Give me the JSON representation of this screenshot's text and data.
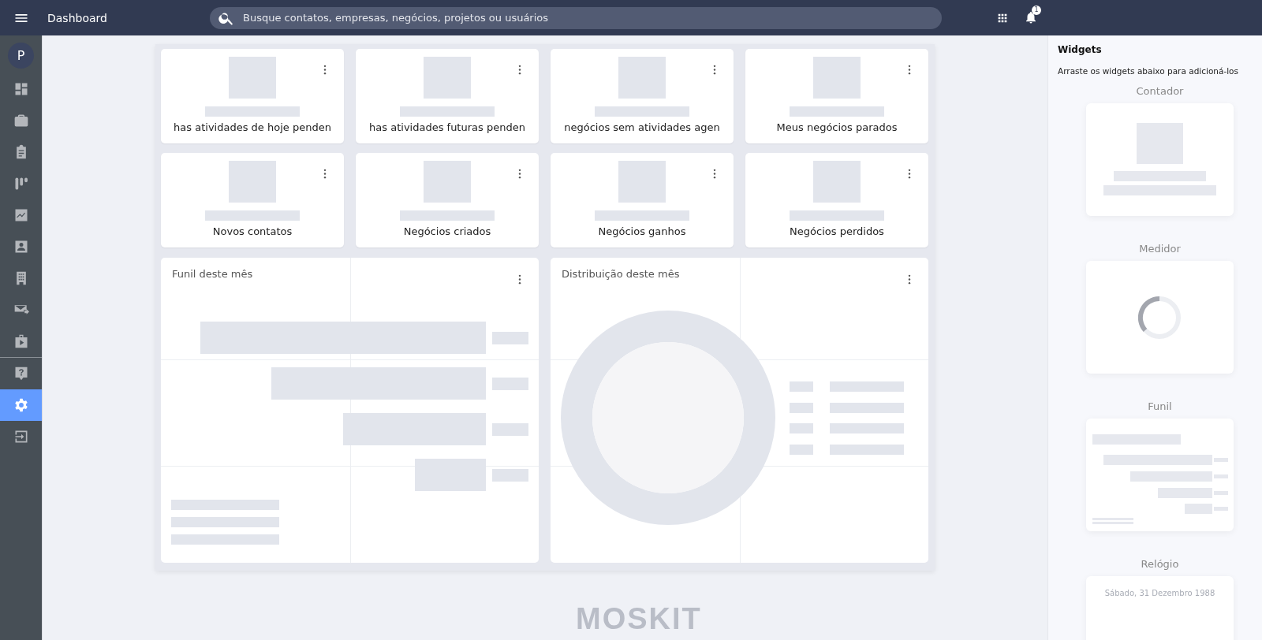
{
  "topbar": {
    "title": "Dashboard",
    "search": {
      "placeholder": "Busque contatos, empresas, negócios, projetos ou usuários"
    },
    "notifications": "1"
  },
  "sidebar": {
    "avatar": "P",
    "items": [
      {
        "kind": "dashboard",
        "selected": false
      },
      {
        "kind": "briefcase",
        "selected": false
      },
      {
        "kind": "clipboard",
        "selected": false
      },
      {
        "kind": "kanban",
        "selected": false
      },
      {
        "kind": "chart",
        "selected": false
      },
      {
        "kind": "contact",
        "selected": false
      },
      {
        "kind": "building",
        "selected": false
      },
      {
        "kind": "mail",
        "selected": false
      },
      {
        "kind": "bag",
        "selected": false
      },
      {
        "kind": "help",
        "selected": false
      },
      {
        "kind": "settings",
        "selected": true
      },
      {
        "kind": "logout",
        "selected": false
      }
    ]
  },
  "tiles": [
    {
      "label": "has atividades de hoje penden"
    },
    {
      "label": "has atividades futuras penden"
    },
    {
      "label": "negócios sem atividades agen"
    },
    {
      "label": "Meus negócios parados"
    },
    {
      "label": "Novos contatos"
    },
    {
      "label": "Negócios criados"
    },
    {
      "label": "Negócios ganhos"
    },
    {
      "label": "Negócios perdidos"
    }
  ],
  "charts": [
    {
      "kind": "funnel",
      "title": "Funil deste mês"
    },
    {
      "kind": "donut",
      "title": "Distribuição deste mês"
    }
  ],
  "footer_logo": "MOSKIT",
  "widgets_panel": {
    "title": "Widgets",
    "hint": "Arraste os widgets abaixo para adicioná-los",
    "widgets": [
      {
        "kind": "counter",
        "label": "Contador"
      },
      {
        "kind": "gauge",
        "label": "Medidor"
      },
      {
        "kind": "funnel",
        "label": "Funil"
      },
      {
        "kind": "clock",
        "label": "Relógio",
        "text": "Sábado, 31 Dezembro 1988"
      }
    ]
  }
}
